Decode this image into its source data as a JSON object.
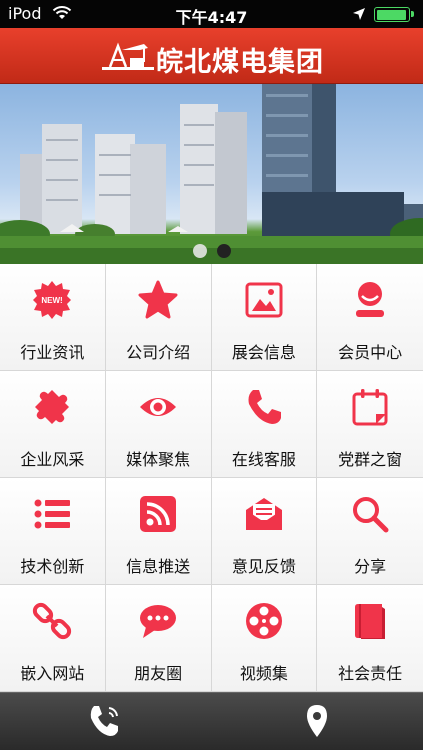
{
  "status_bar": {
    "carrier": "iPod",
    "time": "下午4:47",
    "battery_level": 0.95
  },
  "header": {
    "title": "皖北煤电集团",
    "logo": "oil-derrick-logo",
    "color": "#d43a24"
  },
  "banner": {
    "slide_count": 2,
    "active_slide": 2
  },
  "accent_color": "#f0344a",
  "tiles": [
    {
      "label": "行业资讯",
      "icon": "new-badge-icon"
    },
    {
      "label": "公司介绍",
      "icon": "star-icon"
    },
    {
      "label": "展会信息",
      "icon": "picture-icon"
    },
    {
      "label": "会员中心",
      "icon": "user-icon"
    },
    {
      "label": "企业风采",
      "icon": "puzzle-icon"
    },
    {
      "label": "媒体聚焦",
      "icon": "eye-icon"
    },
    {
      "label": "在线客服",
      "icon": "phone-icon"
    },
    {
      "label": "党群之窗",
      "icon": "calendar-icon"
    },
    {
      "label": "技术创新",
      "icon": "list-icon"
    },
    {
      "label": "信息推送",
      "icon": "rss-icon"
    },
    {
      "label": "意见反馈",
      "icon": "envelope-icon"
    },
    {
      "label": "分享",
      "icon": "search-icon"
    },
    {
      "label": "嵌入网站",
      "icon": "link-icon"
    },
    {
      "label": "朋友圈",
      "icon": "chat-bubble-icon"
    },
    {
      "label": "视频集",
      "icon": "film-reel-icon"
    },
    {
      "label": "社会责任",
      "icon": "book-icon"
    }
  ],
  "bottom_bar": {
    "left_icon": "phone-call-icon",
    "right_icon": "location-pin-icon"
  },
  "new_badge_text": "NEW!"
}
